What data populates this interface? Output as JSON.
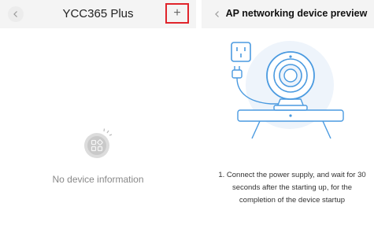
{
  "left_screen": {
    "title": "YCC365 Plus",
    "add_label": "+",
    "empty_message": "No device information"
  },
  "right_screen": {
    "title": "AP networking device preview",
    "instruction": "1. Connect the power supply, and wait for 30 seconds after the starting up, for the completion of the device startup"
  },
  "colors": {
    "accent": "#4a9ae0",
    "highlight_border": "#e0242b"
  }
}
